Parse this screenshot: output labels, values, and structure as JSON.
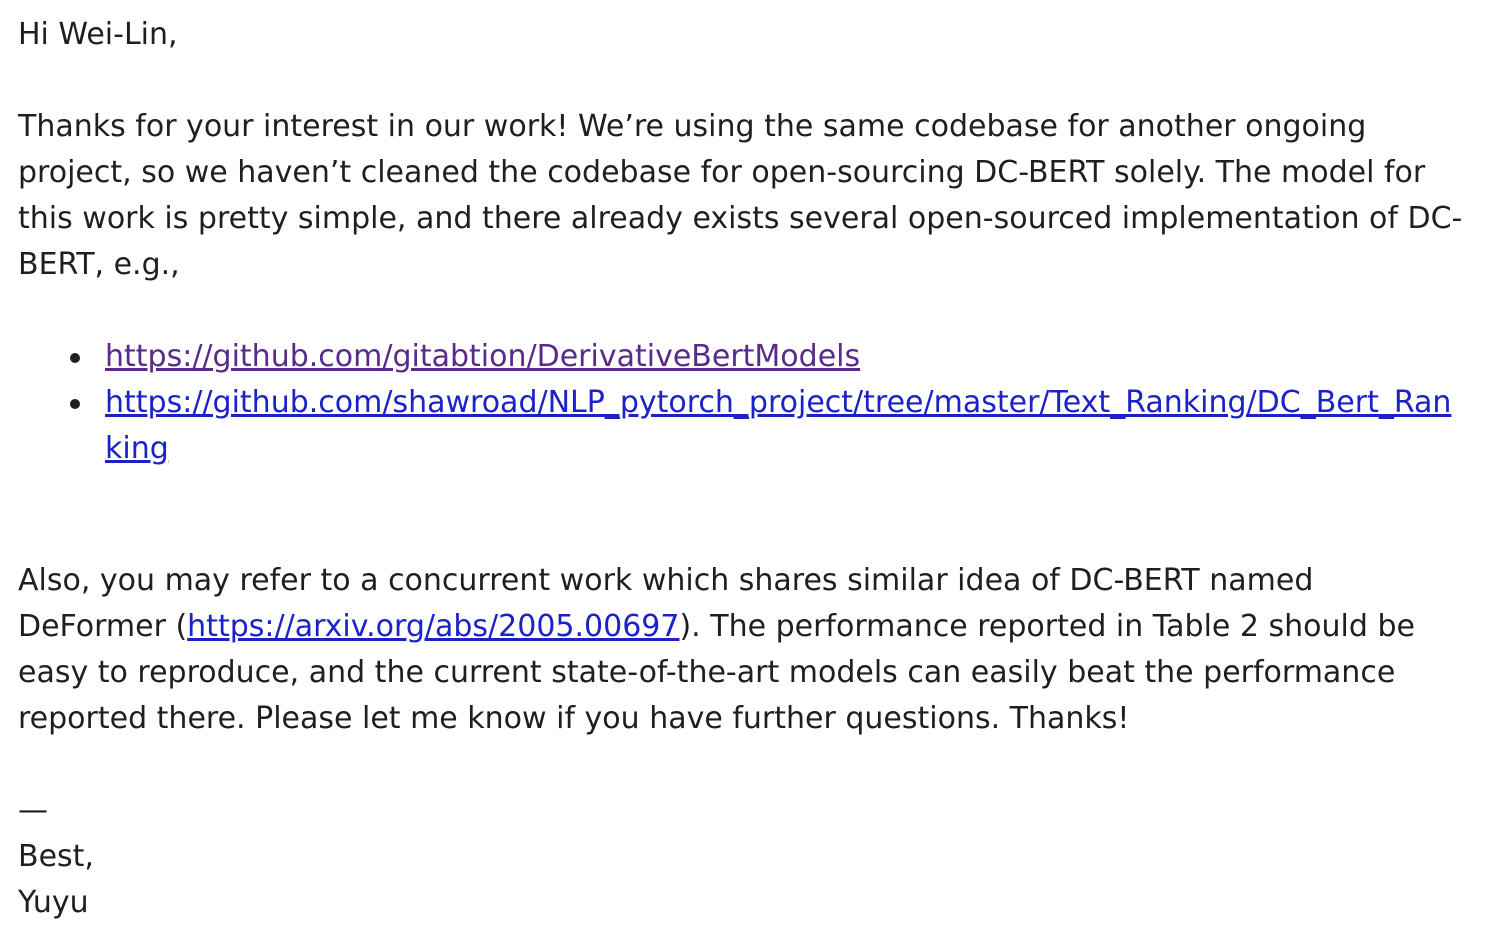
{
  "email": {
    "greeting": "Hi Wei-Lin,",
    "paragraph1": "Thanks for your interest in our work! We’re using the same codebase for another ongoing project, so we haven’t cleaned the codebase for open-sourcing DC-BERT solely. The model for this work is pretty simple, and there already exists several open-sourced implementation of DC-BERT, e.g.,",
    "links": [
      {
        "text": "https://github.com/gitabtion/DerivativeBertModels"
      },
      {
        "text": "https://github.com/shawroad/NLP_pytorch_project/tree/master/Text_Ranking/DC_Bert_Ranking"
      }
    ],
    "paragraph2_before_link": "Also, you may refer to a concurrent work which shares similar idea of DC-BERT named DeFormer (",
    "paragraph2_link": "https://arxiv.org/abs/2005.00697",
    "paragraph2_after_link": ").  The performance reported in Table 2 should be easy to reproduce, and the current state-of-the-art models can easily beat the performance reported there. Please let me know if you have further questions. Thanks!",
    "signature_dash": "—",
    "signoff": "Best,",
    "sender": "Yuyu"
  },
  "colors": {
    "text": "#1f1f1f",
    "visited_link": "#5a2a8a",
    "link": "#1a22c8"
  }
}
